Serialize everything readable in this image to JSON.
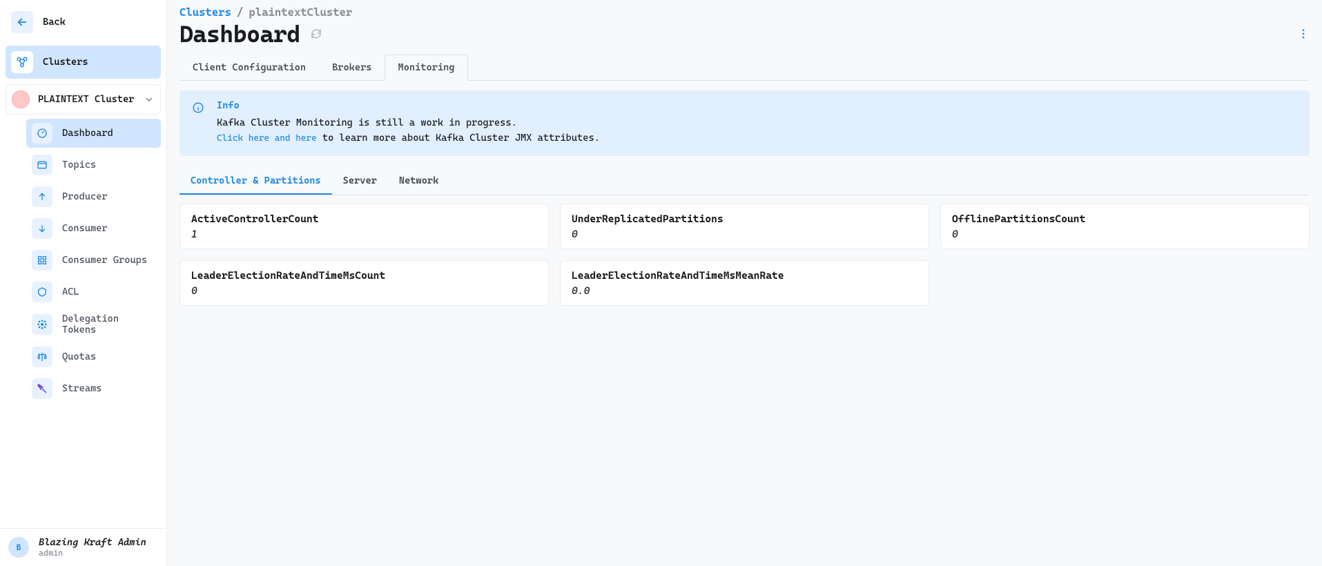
{
  "sidebar": {
    "back_label": "Back",
    "clusters_label": "Clusters",
    "cluster_name": "PLAINTEXT Cluster",
    "items": [
      {
        "label": "Dashboard"
      },
      {
        "label": "Topics"
      },
      {
        "label": "Producer"
      },
      {
        "label": "Consumer"
      },
      {
        "label": "Consumer Groups"
      },
      {
        "label": "ACL"
      },
      {
        "label": "Delegation Tokens"
      },
      {
        "label": "Quotas"
      },
      {
        "label": "Streams"
      }
    ]
  },
  "footer": {
    "initial": "B",
    "name": "Blazing Kraft Admin",
    "sub": "admin"
  },
  "breadcrumb": {
    "root": "Clusters",
    "sep": "/",
    "current": "plaintextCluster"
  },
  "page": {
    "title": "Dashboard"
  },
  "tabs": {
    "t1": "Client Configuration",
    "t2": "Brokers",
    "t3": "Monitoring"
  },
  "info": {
    "title": "Info",
    "line1": "Kafka Cluster Monitoring is still a work in progress.",
    "link1": "Click here",
    "and": " and ",
    "link2": "here",
    "line2_rest": " to learn more about Kafka Cluster JMX attributes."
  },
  "mon_tabs": {
    "t1": "Controller & Partitions",
    "t2": "Server",
    "t3": "Network"
  },
  "cards": [
    {
      "title": "ActiveControllerCount",
      "value": "1"
    },
    {
      "title": "UnderReplicatedPartitions",
      "value": "0"
    },
    {
      "title": "OfflinePartitionsCount",
      "value": "0"
    },
    {
      "title": "LeaderElectionRateAndTimeMsCount",
      "value": "0"
    },
    {
      "title": "LeaderElectionRateAndTimeMsMeanRate",
      "value": "0.0"
    }
  ]
}
